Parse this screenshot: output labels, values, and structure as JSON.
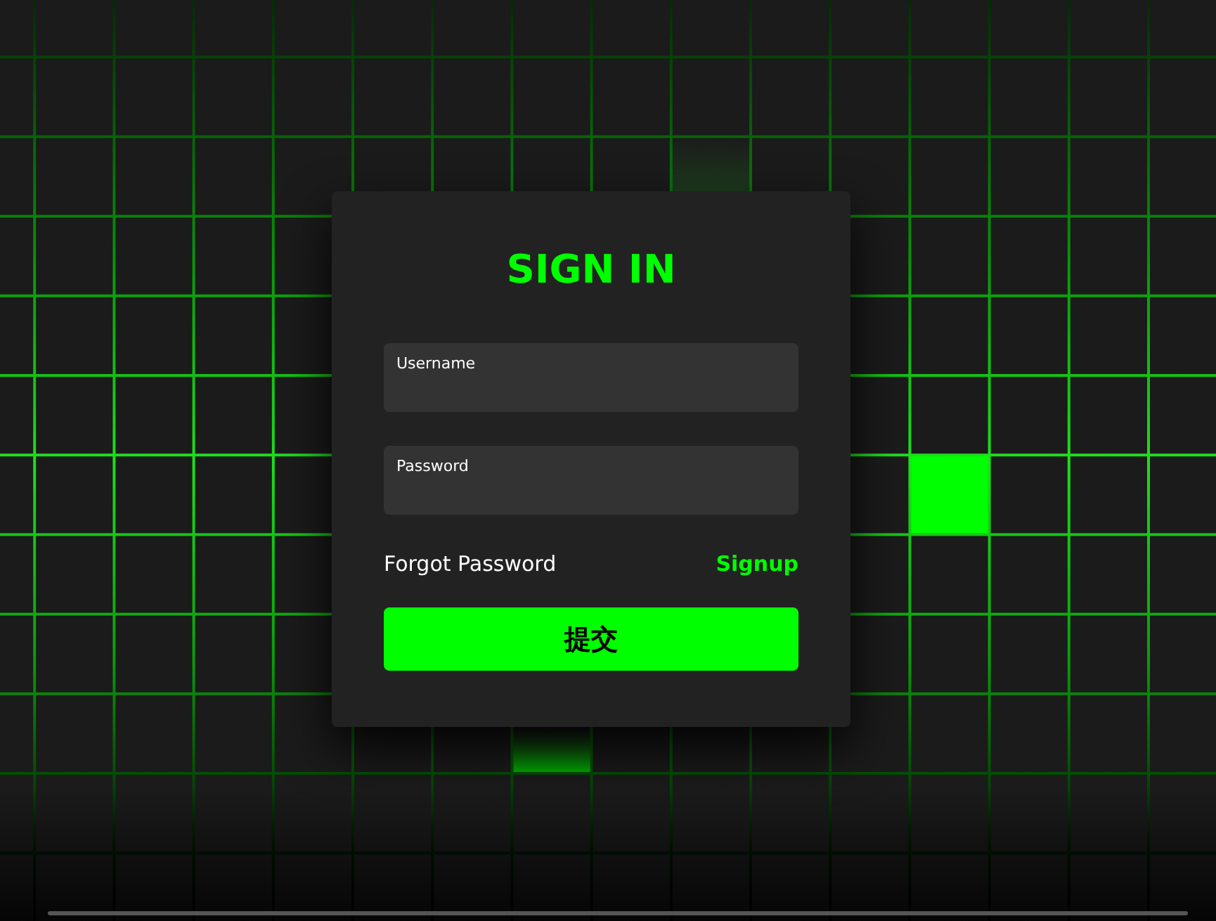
{
  "form": {
    "title": "SIGN IN",
    "fields": [
      {
        "label": "Username"
      },
      {
        "label": "Password"
      }
    ],
    "links": [
      {
        "text": "Forgot Password",
        "kind": "plain"
      },
      {
        "text": "Signup",
        "kind": "accent"
      }
    ],
    "submit": "提交"
  }
}
